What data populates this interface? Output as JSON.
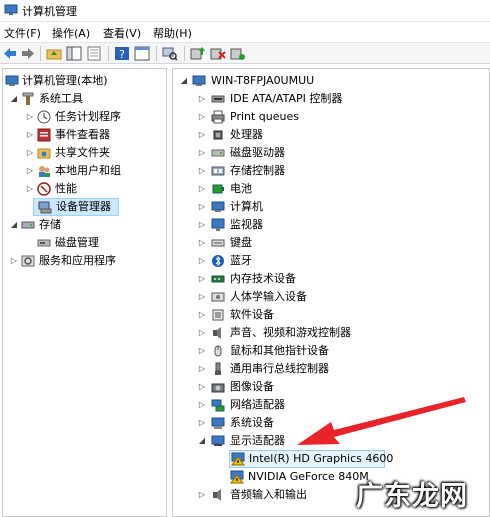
{
  "window": {
    "title": "计算机管理"
  },
  "menu": [
    "文件(F)",
    "操作(A)",
    "查看(V)",
    "帮助(H)"
  ],
  "toolbar_icons": [
    "back-arrow-icon",
    "forward-arrow-icon",
    "up-folder-icon",
    "show-hide-tree-icon",
    "properties-icon",
    "help-icon",
    "show-console-icon",
    "scan-hardware-icon",
    "update-driver-icon",
    "uninstall-device-icon",
    "enable-device-icon"
  ],
  "left_tree": [
    {
      "label": "计算机管理(本地)",
      "icon": "computer-management-icon"
    },
    {
      "label": "系统工具",
      "icon": "system-tools-icon"
    },
    {
      "label": "任务计划程序",
      "icon": "task-scheduler-icon"
    },
    {
      "label": "事件查看器",
      "icon": "event-viewer-icon"
    },
    {
      "label": "共享文件夹",
      "icon": "shared-folders-icon"
    },
    {
      "label": "本地用户和组",
      "icon": "local-users-icon"
    },
    {
      "label": "性能",
      "icon": "performance-icon"
    },
    {
      "label": "设备管理器",
      "icon": "device-manager-icon"
    },
    {
      "label": "存储",
      "icon": "storage-icon"
    },
    {
      "label": "磁盘管理",
      "icon": "disk-management-icon"
    },
    {
      "label": "服务和应用程序",
      "icon": "services-icon"
    }
  ],
  "device_tree": {
    "root": "WIN-T8FPJA0UMUU",
    "categories": [
      {
        "label": "IDE ATA/ATAPI 控制器",
        "icon": "ide-controller-icon"
      },
      {
        "label": "Print queues",
        "icon": "printer-icon"
      },
      {
        "label": "处理器",
        "icon": "processor-icon"
      },
      {
        "label": "磁盘驱动器",
        "icon": "disk-drive-icon"
      },
      {
        "label": "存储控制器",
        "icon": "storage-controller-icon"
      },
      {
        "label": "电池",
        "icon": "battery-icon"
      },
      {
        "label": "计算机",
        "icon": "computer-icon"
      },
      {
        "label": "监视器",
        "icon": "monitor-icon"
      },
      {
        "label": "键盘",
        "icon": "keyboard-icon"
      },
      {
        "label": "蓝牙",
        "icon": "bluetooth-icon"
      },
      {
        "label": "内存技术设备",
        "icon": "memory-device-icon"
      },
      {
        "label": "人体学输入设备",
        "icon": "hid-icon"
      },
      {
        "label": "软件设备",
        "icon": "software-device-icon"
      },
      {
        "label": "声音、视频和游戏控制器",
        "icon": "sound-icon"
      },
      {
        "label": "鼠标和其他指针设备",
        "icon": "mouse-icon"
      },
      {
        "label": "通用串行总线控制器",
        "icon": "usb-icon"
      },
      {
        "label": "图像设备",
        "icon": "imaging-device-icon"
      },
      {
        "label": "网络适配器",
        "icon": "network-adapter-icon"
      },
      {
        "label": "系统设备",
        "icon": "system-device-icon"
      },
      {
        "label": "显示适配器",
        "icon": "display-adapter-icon"
      }
    ],
    "display_children": [
      "Intel(R) HD Graphics 4600",
      "NVIDIA GeForce 840M"
    ],
    "last_category": {
      "label": "音频输入和输出",
      "icon": "audio-io-icon"
    }
  },
  "watermark": "广东龙网",
  "colors": {
    "selection": "#cce8ff",
    "arrow": "#e8232a",
    "warning": "#f2c200"
  }
}
